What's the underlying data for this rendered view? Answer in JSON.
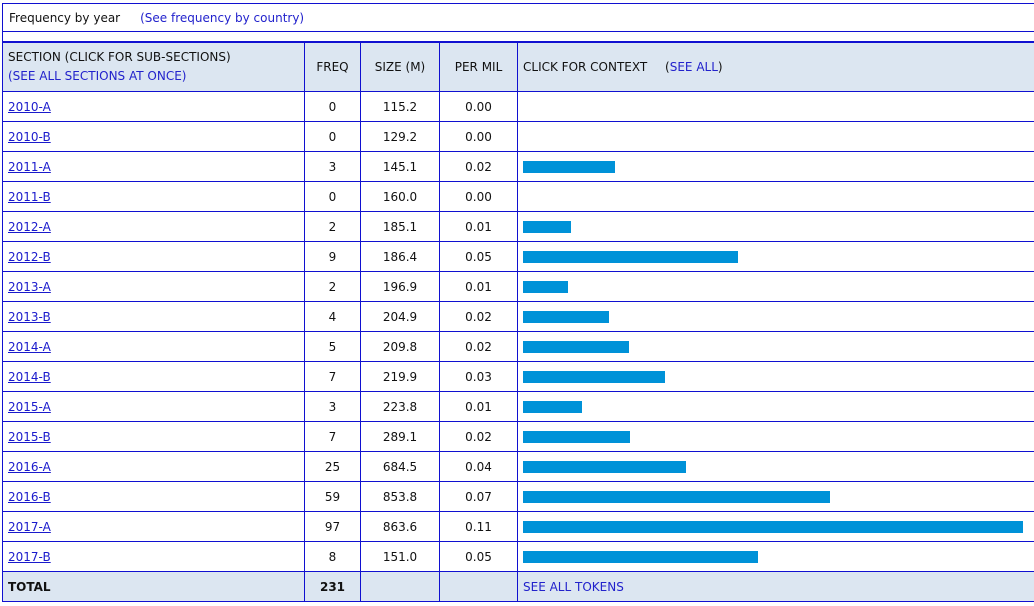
{
  "header": {
    "title": "Frequency by year",
    "alt_link": "(See frequency by country)"
  },
  "table": {
    "columns": {
      "section": "SECTION (CLICK FOR SUB-SECTIONS)",
      "see_all_sections": "(SEE ALL SECTIONS AT ONCE)",
      "freq": "FREQ",
      "size": "SIZE (M)",
      "per_mil": "PER MIL",
      "context": "CLICK FOR CONTEXT",
      "context_open": "(",
      "see_all": "SEE ALL",
      "context_close": ")"
    },
    "rows": [
      {
        "section": "2010-A",
        "freq": "0",
        "size": "115.2",
        "per_mil": "0.00",
        "bar_fraction": 0
      },
      {
        "section": "2010-B",
        "freq": "0",
        "size": "129.2",
        "per_mil": "0.00",
        "bar_fraction": 0
      },
      {
        "section": "2011-A",
        "freq": "3",
        "size": "145.1",
        "per_mil": "0.02",
        "bar_fraction": 0.184
      },
      {
        "section": "2011-B",
        "freq": "0",
        "size": "160.0",
        "per_mil": "0.00",
        "bar_fraction": 0
      },
      {
        "section": "2012-A",
        "freq": "2",
        "size": "185.1",
        "per_mil": "0.01",
        "bar_fraction": 0.096
      },
      {
        "section": "2012-B",
        "freq": "9",
        "size": "186.4",
        "per_mil": "0.05",
        "bar_fraction": 0.429
      },
      {
        "section": "2013-A",
        "freq": "2",
        "size": "196.9",
        "per_mil": "0.01",
        "bar_fraction": 0.09
      },
      {
        "section": "2013-B",
        "freq": "4",
        "size": "204.9",
        "per_mil": "0.02",
        "bar_fraction": 0.172
      },
      {
        "section": "2014-A",
        "freq": "5",
        "size": "209.8",
        "per_mil": "0.02",
        "bar_fraction": 0.212
      },
      {
        "section": "2014-B",
        "freq": "7",
        "size": "219.9",
        "per_mil": "0.03",
        "bar_fraction": 0.283
      },
      {
        "section": "2015-A",
        "freq": "3",
        "size": "223.8",
        "per_mil": "0.01",
        "bar_fraction": 0.118
      },
      {
        "section": "2015-B",
        "freq": "7",
        "size": "289.1",
        "per_mil": "0.02",
        "bar_fraction": 0.214
      },
      {
        "section": "2016-A",
        "freq": "25",
        "size": "684.5",
        "per_mil": "0.04",
        "bar_fraction": 0.325
      },
      {
        "section": "2016-B",
        "freq": "59",
        "size": "853.8",
        "per_mil": "0.07",
        "bar_fraction": 0.613
      },
      {
        "section": "2017-A",
        "freq": "97",
        "size": "863.6",
        "per_mil": "0.11",
        "bar_fraction": 1.0
      },
      {
        "section": "2017-B",
        "freq": "8",
        "size": "151.0",
        "per_mil": "0.05",
        "bar_fraction": 0.469
      }
    ],
    "footer": {
      "label": "TOTAL",
      "freq": "231",
      "see_all_tokens": "SEE ALL TOKENS"
    }
  },
  "colors": {
    "border": "#1010d0",
    "header_bg": "#dce6f1",
    "bar": "#0092d8",
    "link": "#2222cc"
  }
}
